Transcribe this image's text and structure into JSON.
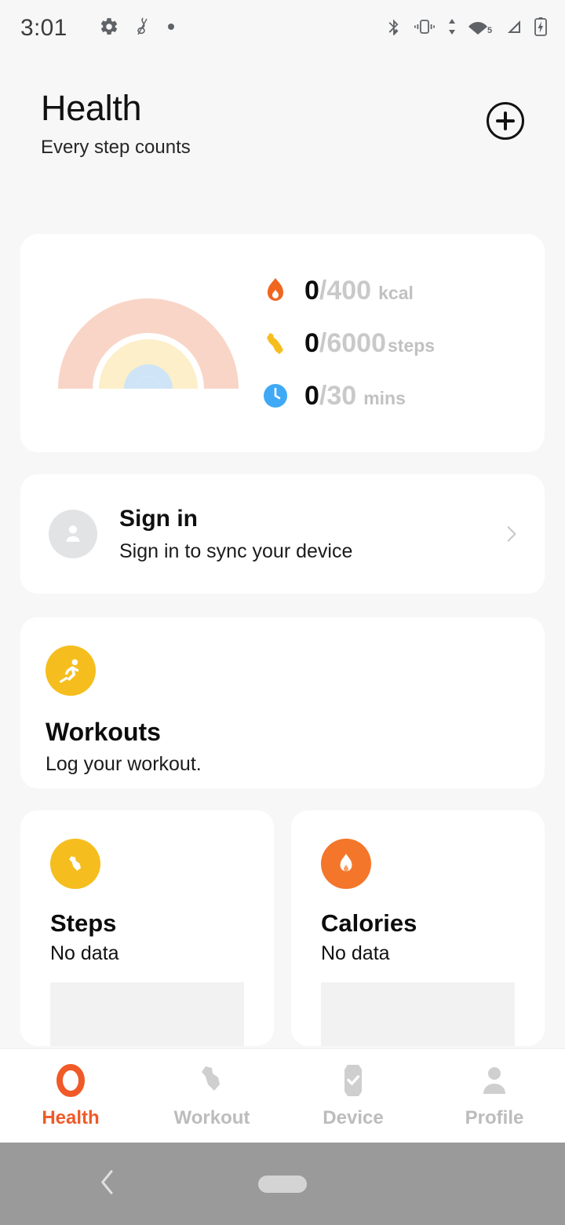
{
  "statusbar": {
    "time": "3:01",
    "left_icons": [
      "gear-icon",
      "music-note-icon",
      "dot-icon"
    ],
    "right_icons": [
      "bluetooth-icon",
      "vibrate-icon",
      "data-transfer-icon",
      "wifi-icon",
      "cellular-signal-icon",
      "battery-charging-icon"
    ],
    "wifi_label": "5"
  },
  "header": {
    "title": "Health",
    "subtitle": "Every step counts",
    "add_button": "add-circle-icon"
  },
  "summary": {
    "illustration": "rainbow-illustration",
    "stats": [
      {
        "icon": "flame-icon",
        "current": "0",
        "goal": "/400",
        "unit": "kcal",
        "color": "#f0661f"
      },
      {
        "icon": "shoe-icon",
        "current": "0",
        "goal": "/6000",
        "unit": "steps",
        "color": "#f5be1e"
      },
      {
        "icon": "clock-icon",
        "current": "0",
        "goal": "/30",
        "unit": "mins",
        "color": "#3fa9f5"
      }
    ]
  },
  "signin": {
    "icon": "person-avatar-icon",
    "title": "Sign in",
    "subtitle": "Sign in to sync your device",
    "chevron": "chevron-right-icon"
  },
  "workouts": {
    "icon": "running-person-icon",
    "icon_color": "#f5be1e",
    "title": "Workouts",
    "subtitle": "Log your workout."
  },
  "metrics": [
    {
      "icon": "shoe-icon",
      "icon_color": "#f5be1e",
      "title": "Steps",
      "value": "No data"
    },
    {
      "icon": "flame-icon",
      "icon_color": "#f4762a",
      "title": "Calories",
      "value": "No data"
    }
  ],
  "bottom_nav": {
    "active_color": "#f05a28",
    "inactive_color": "#bcbcbc",
    "items": [
      {
        "icon": "ring-icon",
        "label": "Health",
        "active": true
      },
      {
        "icon": "shoe-icon",
        "label": "Workout",
        "active": false
      },
      {
        "icon": "watch-check-icon",
        "label": "Device",
        "active": false
      },
      {
        "icon": "person-icon",
        "label": "Profile",
        "active": false
      }
    ]
  },
  "android_nav": {
    "back": "back-chevron-icon",
    "home": "home-pill-indicator"
  },
  "theme": {
    "background": "#f7f7f7",
    "card": "#ffffff",
    "accent": "#f05a28",
    "rainbow_outer": "#f9d5c7",
    "rainbow_middle": "#fcefc9",
    "rainbow_inner": "#cfe5f7"
  }
}
